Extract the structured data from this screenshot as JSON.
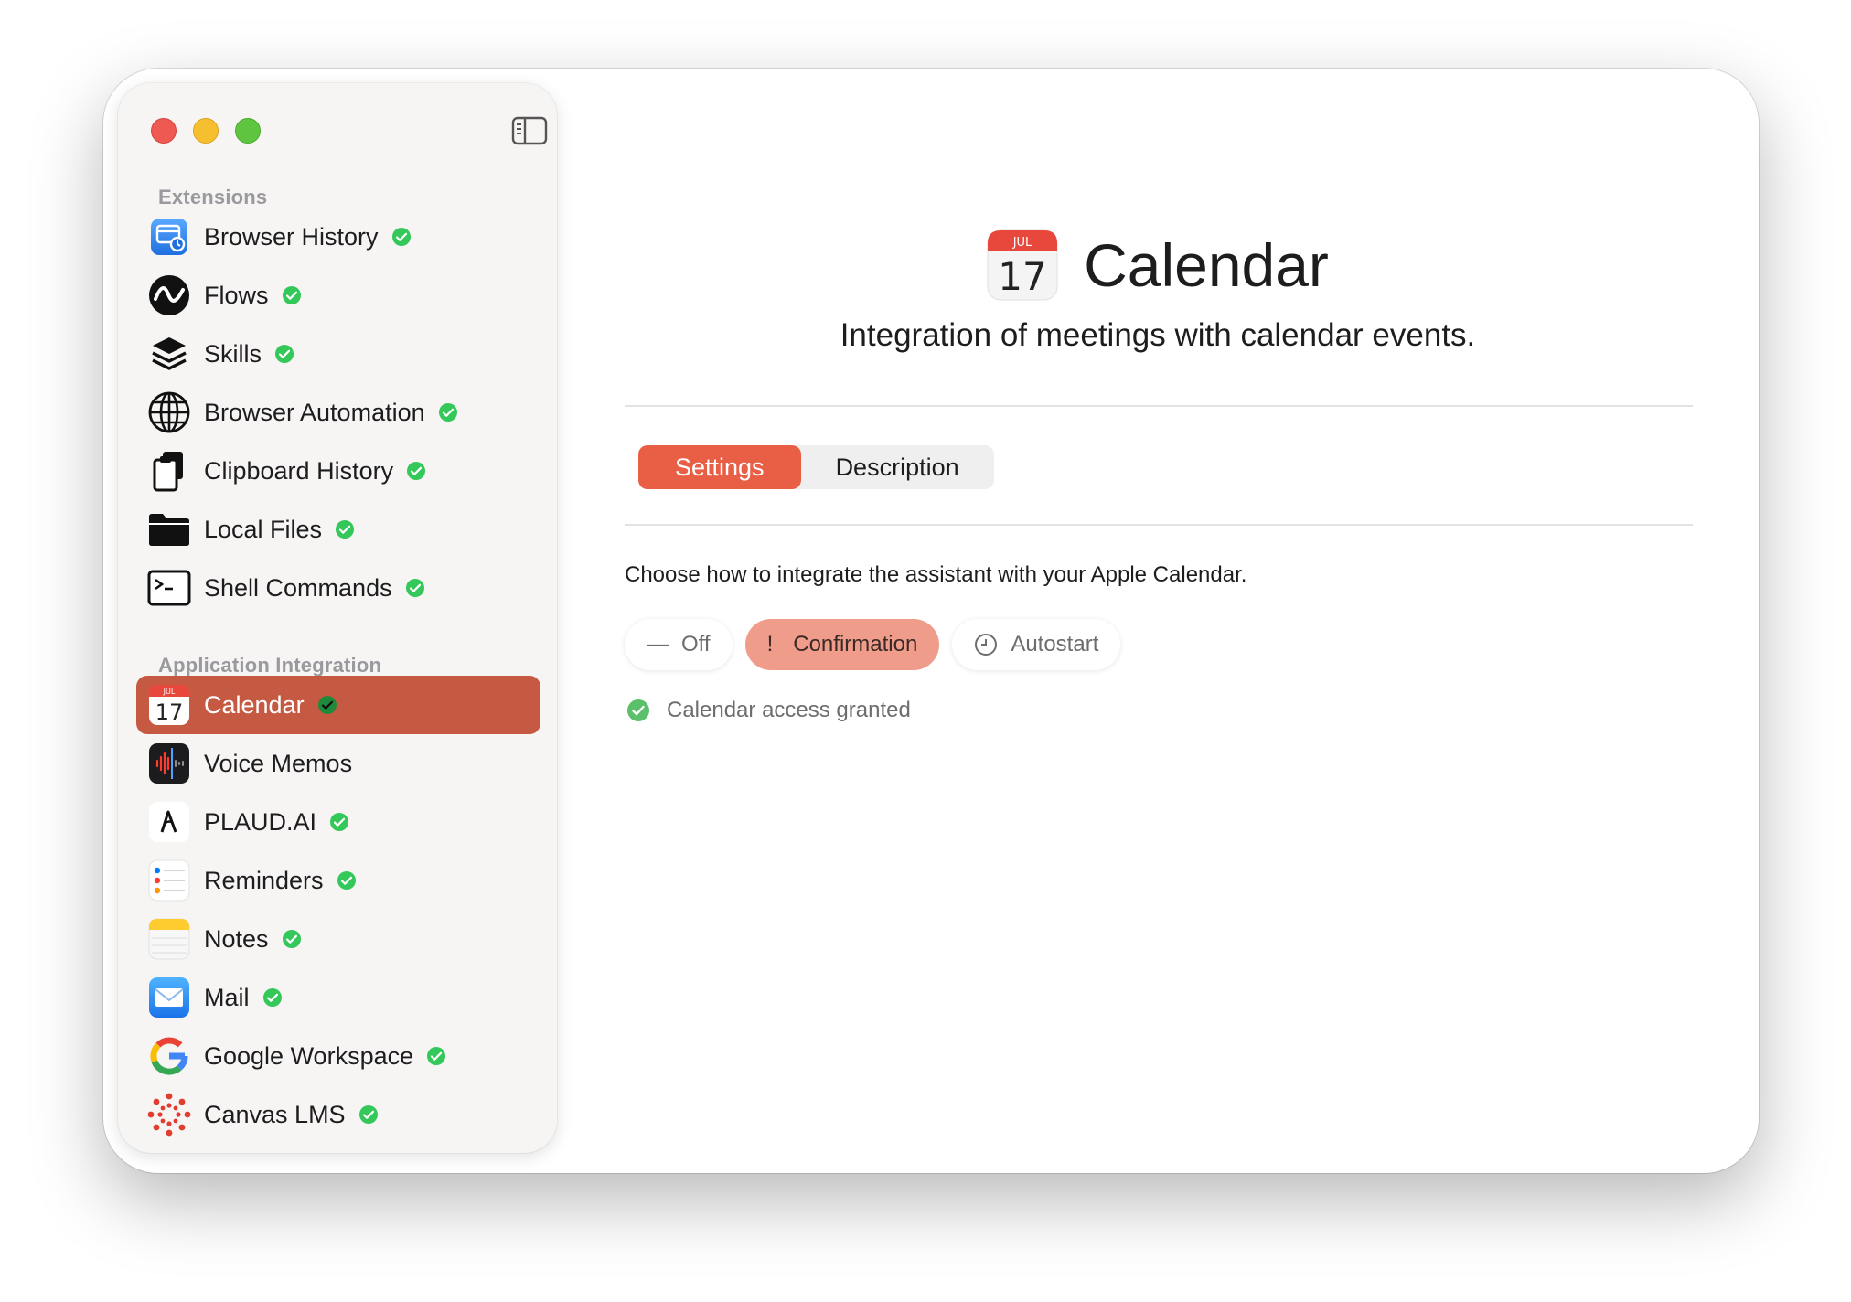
{
  "sidebar": {
    "sections": {
      "extensions": "Extensions",
      "app_integration": "Application Integration"
    },
    "extensions": [
      {
        "label": "Browser History",
        "icon": "browser-history-icon"
      },
      {
        "label": "Flows",
        "icon": "flows-icon"
      },
      {
        "label": "Skills",
        "icon": "skills-icon"
      },
      {
        "label": "Browser Automation",
        "icon": "globe-icon"
      },
      {
        "label": "Clipboard History",
        "icon": "clipboard-icon"
      },
      {
        "label": "Local Files",
        "icon": "folder-icon"
      },
      {
        "label": "Shell Commands",
        "icon": "terminal-icon"
      }
    ],
    "integrations": [
      {
        "label": "Calendar",
        "icon": "calendar-icon",
        "active": true,
        "checked": true
      },
      {
        "label": "Voice Memos",
        "icon": "voice-memos-icon",
        "checked": false
      },
      {
        "label": "PLAUD.AI",
        "icon": "plaud-icon",
        "checked": true
      },
      {
        "label": "Reminders",
        "icon": "reminders-icon",
        "checked": true
      },
      {
        "label": "Notes",
        "icon": "notes-icon",
        "checked": true
      },
      {
        "label": "Mail",
        "icon": "mail-icon",
        "checked": true
      },
      {
        "label": "Google Workspace",
        "icon": "google-icon",
        "checked": true
      },
      {
        "label": "Canvas LMS",
        "icon": "canvas-icon",
        "checked": true
      }
    ],
    "calendar_icon_month": "JUL",
    "calendar_icon_day": "17"
  },
  "main": {
    "title": "Calendar",
    "subtitle": "Integration of meetings with calendar events.",
    "calendar_month": "JUL",
    "calendar_day": "17",
    "tabs": [
      {
        "label": "Settings",
        "active": true
      },
      {
        "label": "Description",
        "active": false
      }
    ],
    "intro": "Choose how to integrate the assistant with your Apple Calendar.",
    "modes": [
      {
        "label": "Off",
        "glyph": "—"
      },
      {
        "label": "Confirmation",
        "glyph": "!",
        "active": true
      },
      {
        "label": "Autostart",
        "glyph": "clock-icon"
      }
    ],
    "status": "Calendar access granted"
  },
  "colors": {
    "accent": "#e85f46",
    "sidebar_active": "#c65942",
    "mode_active": "#f09c8b",
    "check_green": "#34c759"
  }
}
